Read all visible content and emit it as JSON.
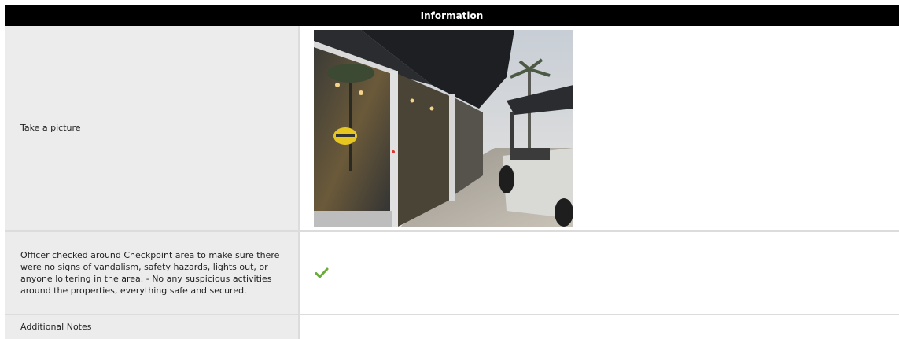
{
  "header": {
    "title": "Information"
  },
  "rows": [
    {
      "label": "Take a picture"
    },
    {
      "label": "Officer checked around Checkpoint area to make sure there were no signs of vandalism, safety hazards, lights out, or anyone loitering in the area. - No any suspicious activities around the properties, everything safe and secured.",
      "checked": true
    },
    {
      "label": "Additional Notes"
    }
  ],
  "icons": {
    "check": "checkmark-icon"
  },
  "colors": {
    "header_bg": "#000000",
    "label_bg": "#ececec",
    "check": "#6aab3a"
  }
}
